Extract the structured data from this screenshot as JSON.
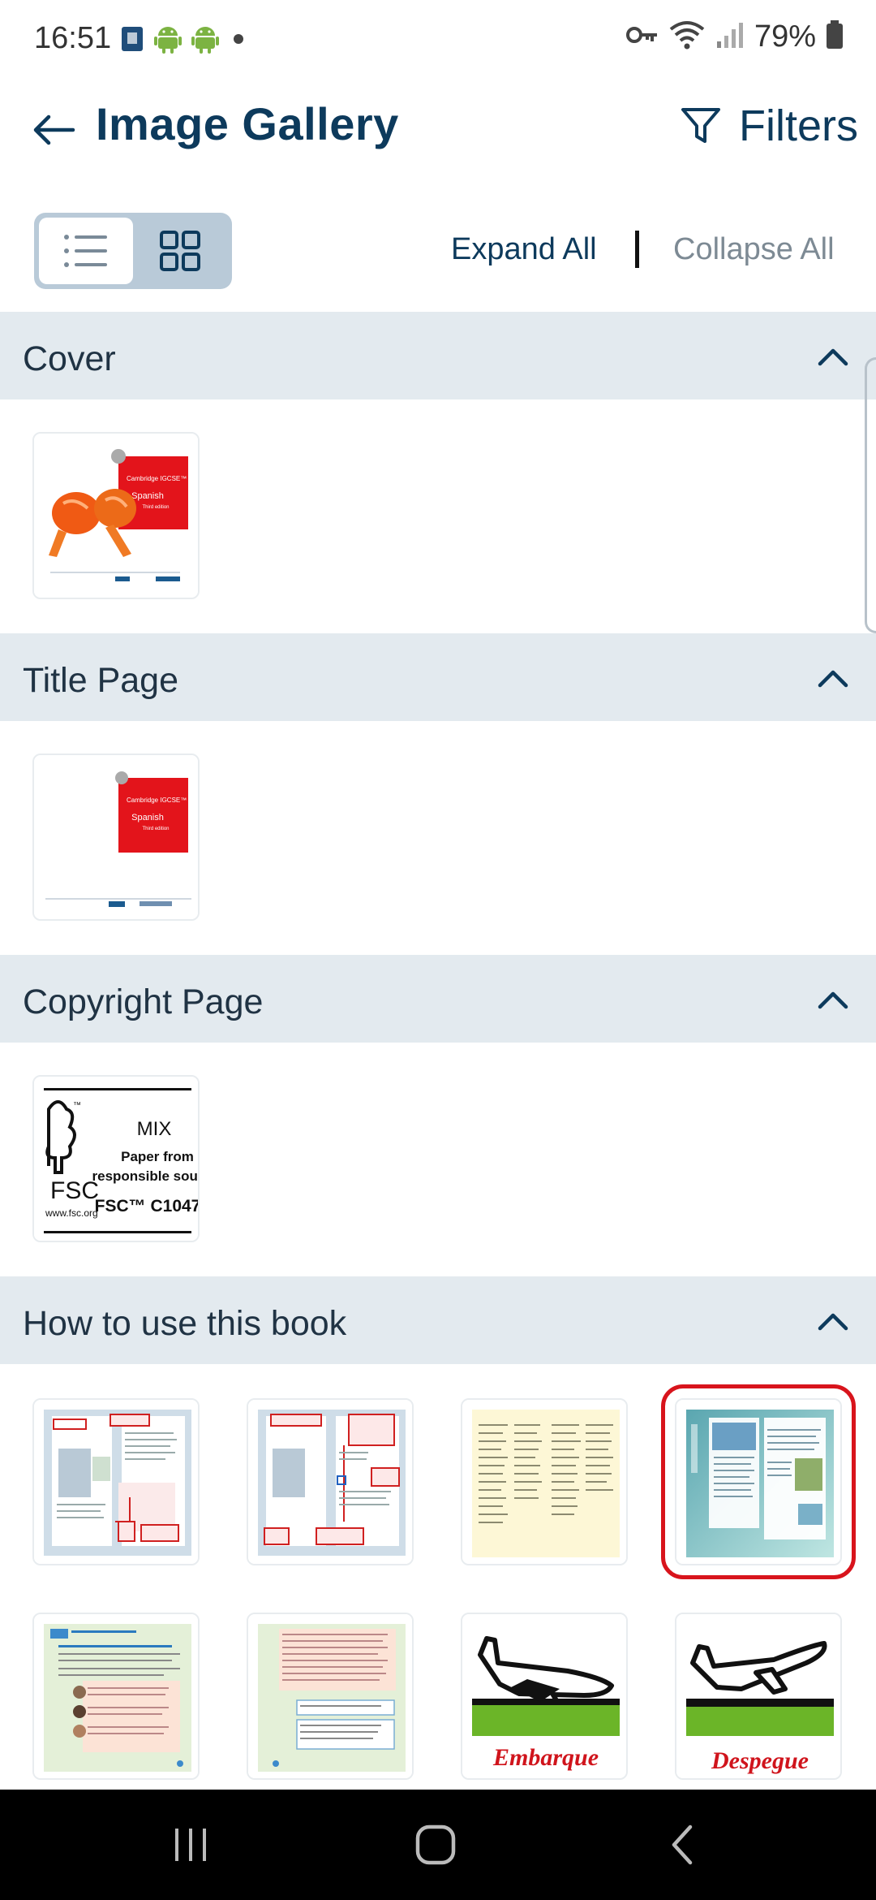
{
  "status_bar": {
    "time": "16:51",
    "battery": "79%",
    "icons": [
      "notification-icon",
      "android-icon",
      "android-icon",
      "dot-icon",
      "vpn-key-icon",
      "wifi-icon",
      "signal-icon",
      "battery-icon"
    ]
  },
  "header": {
    "title": "Image Gallery",
    "filters_label": "Filters",
    "back_icon": "arrow-left-icon",
    "filter_icon": "funnel-icon"
  },
  "toolbar": {
    "expand_all": "Expand All",
    "collapse_all": "Collapse All",
    "view_modes": [
      "list",
      "grid"
    ],
    "active_view": "grid"
  },
  "sections": [
    {
      "title": "Cover",
      "expanded": true
    },
    {
      "title": "Title Page",
      "expanded": true
    },
    {
      "title": "Copyright Page",
      "expanded": true
    },
    {
      "title": "How to use this book",
      "expanded": true
    }
  ],
  "thumbnails": {
    "cover": {
      "brand": "Cambridge IGCSE™",
      "subject": "Spanish",
      "edition": "Third edition"
    },
    "title_page": {
      "brand": "Cambridge IGCSE™",
      "subject": "Spanish",
      "edition": "Third edition"
    },
    "copyright": {
      "mix": "MIX",
      "line1": "Paper from",
      "line2": "responsible sour",
      "code": "FSC™ C1047",
      "fsc": "FSC",
      "url": "www.fsc.org"
    },
    "embarque": "Embarque",
    "despegue": "Despegue"
  },
  "colors": {
    "brand_navy": "#0d3a5c",
    "section_bg": "#e3eaef",
    "selection": "#d8141c",
    "toggle_bg": "#b9cad8"
  }
}
